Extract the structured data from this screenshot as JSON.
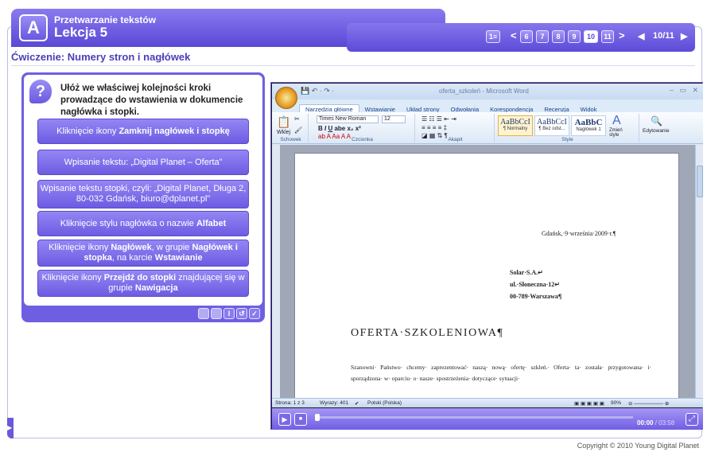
{
  "header": {
    "logo_glyph": "A",
    "app_title": "Przetwarzanie tekstów",
    "lesson_title": "Lekcja 5"
  },
  "navigation": {
    "menu_glyph": "1≡",
    "prev_glyph": "<",
    "next_glyph": ">",
    "pages": [
      "6",
      "7",
      "8",
      "9",
      "10",
      "11"
    ],
    "current_page": "10",
    "back_glyph": "◀",
    "forward_glyph": "▶",
    "counter": "10/11"
  },
  "exercise": {
    "title": "Ćwiczenie: Numery stron i nagłówek",
    "question_glyph": "?",
    "instruction": "Ułóż we właściwej kolejności kroki prowadzące do wstawienia w dokumencie nagłówka i stopki.",
    "steps": [
      {
        "lines": [
          [
            "Kliknięcie ikony ",
            false
          ],
          [
            "Zamknij nagłówek i stopkę",
            true
          ]
        ]
      },
      {
        "lines": [
          [
            "Wpisanie tekstu: „Digital Planet – Oferta”",
            false
          ]
        ]
      },
      {
        "lines": [
          [
            "Wpisanie tekstu stopki, czyli: „Digital Planet, Długa 2, 80-032 Gdańsk, biuro@dplanet.pl”",
            false
          ]
        ]
      },
      {
        "lines": [
          [
            "Kliknięcie stylu nagłówka o nazwie ",
            false
          ],
          [
            "Alfabet",
            true
          ]
        ]
      },
      {
        "lines": [
          [
            "Kliknięcie ikony ",
            false
          ],
          [
            "Nagłówek",
            true
          ],
          [
            ", w grupie ",
            false
          ],
          [
            "Nagłówek i stopka",
            true
          ],
          [
            ", na karcie ",
            false
          ],
          [
            "Wstawianie",
            true
          ]
        ]
      },
      {
        "lines": [
          [
            "Kliknięcie ikony ",
            false
          ],
          [
            "Przejdź do stopki",
            true
          ],
          [
            " znajdującej się w grupie ",
            false
          ],
          [
            "Nawigacja",
            true
          ]
        ]
      }
    ],
    "control_glyphs": [
      "",
      "",
      "I",
      "↺",
      "✓"
    ]
  },
  "word": {
    "title": "oferta_szkoleń - Microsoft Word",
    "tabs": [
      "Narzędzia główne",
      "Wstawianie",
      "Układ strony",
      "Odwołania",
      "Korespondencja",
      "Recenzja",
      "Widok"
    ],
    "font_name": "Times New Roman",
    "font_size": "12",
    "paste_label": "Wklej",
    "groups": [
      "Schowek",
      "Czcionka",
      "Akapit",
      "Style",
      "Edytowanie"
    ],
    "styles": [
      {
        "sample": "AaBbCcI",
        "name": "¶ Normalny"
      },
      {
        "sample": "AaBbCcI",
        "name": "¶ Bez odst..."
      },
      {
        "sample": "AaBbC",
        "name": "Nagłówek 1"
      }
    ],
    "change_styles": "Zmień style",
    "editing": "Edytowanie",
    "doc": {
      "date": "Gdańsk,·9·września·2009·r.¶",
      "address": [
        "Solar·S.A.↵",
        "ul.·Słoneczna·12↵",
        "00-789·Warszawa¶"
      ],
      "heading": "OFERTA·SZKOLENIOWA¶",
      "paragraph": "Szanowni· Państwo· chcemy· zaprezentować· naszą· nową· ofertę· szkleń.· Oferta· ta· została· przygotowana· i· sporządzona· w· oparciu· o· nasze· spostrzeżenia· dotyczące· sytuacji·"
    },
    "status": {
      "page": "Strona: 1 z 3",
      "words": "Wyrazy: 401",
      "language": "Polski (Polska)",
      "zoom": "90%"
    }
  },
  "player": {
    "play_glyph": "▶",
    "stop_glyph": "■",
    "elapsed": "00:00",
    "total": "/ 03:58",
    "progress": 0
  },
  "copyright": "Copyright © 2010 Young Digital Planet"
}
